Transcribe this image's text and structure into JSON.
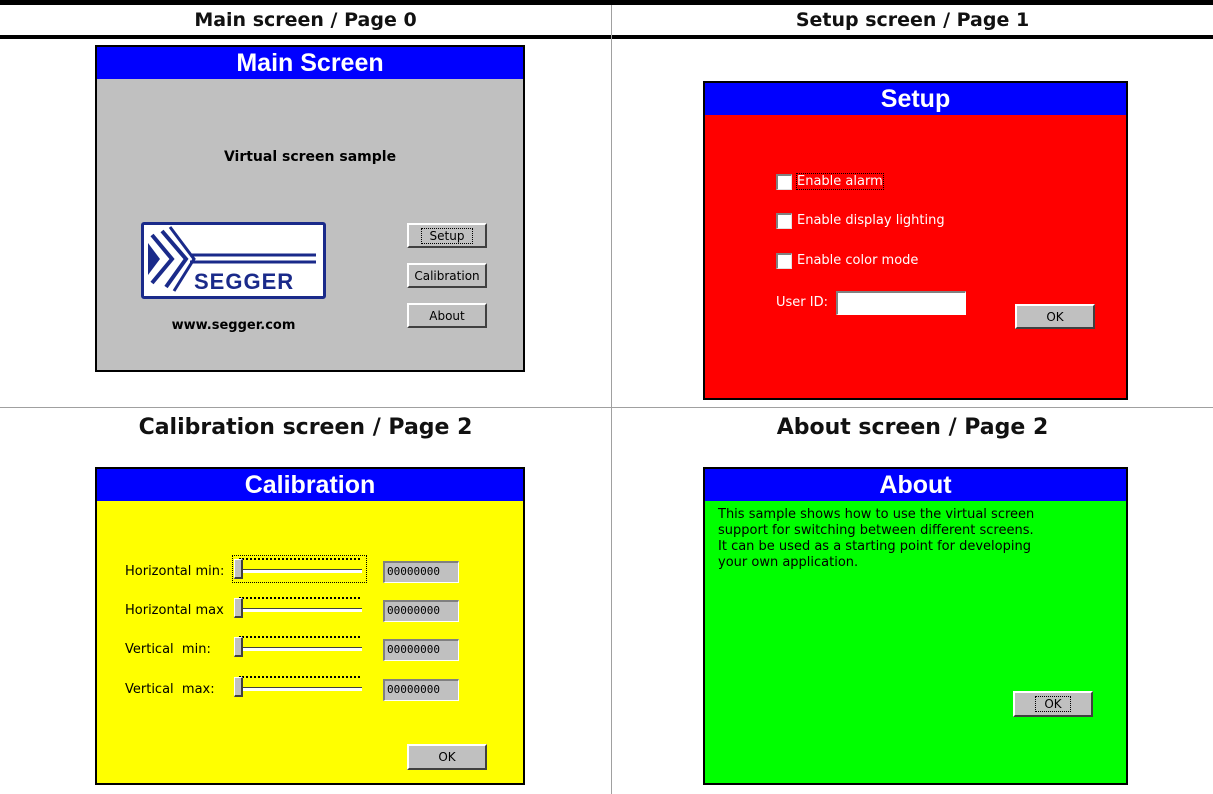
{
  "headers": {
    "main": "Main screen / Page 0",
    "setup": "Setup screen / Page 1",
    "calibration": "Calibration screen / Page 2",
    "about": "About screen / Page 2"
  },
  "main_screen": {
    "title": "Main Screen",
    "subtitle": "Virtual screen sample",
    "logo_text": "SEGGER",
    "url": "www.segger.com",
    "buttons": {
      "setup": "Setup",
      "calibration": "Calibration",
      "about": "About"
    }
  },
  "setup_screen": {
    "title": "Setup",
    "checkboxes": [
      "Enable alarm",
      "Enable display lighting",
      "Enable color mode"
    ],
    "user_id_label": "User ID:",
    "user_id_value": "",
    "ok": "OK"
  },
  "calibration_screen": {
    "title": "Calibration",
    "rows": [
      {
        "label": "Horizontal min:",
        "value": "00000000"
      },
      {
        "label": "Horizontal max",
        "value": "00000000"
      },
      {
        "label": "Vertical  min:",
        "value": "00000000"
      },
      {
        "label": "Vertical  max:",
        "value": "00000000"
      }
    ],
    "ok": "OK"
  },
  "about_screen": {
    "title": "About",
    "text_lines": [
      "This sample shows how to use the virtual screen",
      "support for switching between different screens.",
      "It can be used as a starting point for developing",
      "your own application."
    ],
    "ok": "OK"
  },
  "colors": {
    "title_bar": "#0000ff",
    "main_bg": "#c0c0c0",
    "setup_bg": "#ff0000",
    "calibration_bg": "#ffff00",
    "about_bg": "#00ff00"
  }
}
